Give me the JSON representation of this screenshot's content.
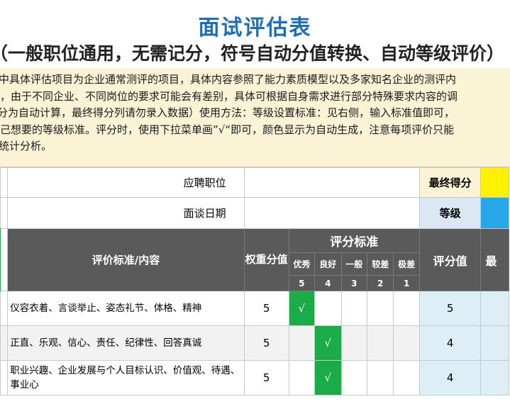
{
  "title": "面试评估表",
  "subtitle": "（一般职位通用，无需记分，符号自动分值转换、自动等级评价）",
  "description_lines": [
    "中具体评估项目为企业通常测评的项目，具体内容参照了能力素质模型以及多家知名企业的测评内",
    "，由于不同企业、不同岗位的要求可能会有差别，具体可根据自身需求进行部分特殊要求内容的调",
    "分为自动计算，最终得分列请勿录入数据）使用方法：等级设置标准：见右侧，输入标准值即可，",
    "己想要的等级标准。评分时，使用下拉菜单画”√“即可，颜色显示为自动生成，注意每项评价只能",
    "统计分析。"
  ],
  "info": {
    "position_label": "应聘职位",
    "position_value": "",
    "date_label": "面谈日期",
    "date_value": "",
    "final_score_label": "最终得分",
    "grade_label": "等级"
  },
  "header": {
    "criteria": "评价标准/内容",
    "weight": "权重分值",
    "standard": "评分标准",
    "score_value": "评分值",
    "cut_label": "最",
    "levels": [
      "优秀",
      "良好",
      "一般",
      "较差",
      "极差"
    ],
    "level_points": [
      "5",
      "4",
      "3",
      "2",
      "1"
    ]
  },
  "rows": [
    {
      "content": "仪容衣着、言谈举止、姿态礼节、体格、精神",
      "weight": "5",
      "checked_level": 0,
      "mark": "√",
      "score": "5"
    },
    {
      "content": "正直、乐观、信心、责任、纪律性、回答真诚",
      "weight": "5",
      "checked_level": 1,
      "mark": "√",
      "score": "4"
    },
    {
      "content": "职业兴趣、企业发展与个人目标认识、价值观、待遇、事业心",
      "weight": "5",
      "checked_level": 1,
      "mark": "√",
      "score": "4"
    }
  ],
  "colors": {
    "title": "#1f6db5",
    "description_bg": "#fbf3d6",
    "header_dark": "#5a5a5a",
    "check_green": "#1bab49",
    "score_bg": "#ddeef7",
    "final_score_fill": "#fff200",
    "grade_fill": "#27a7e7"
  }
}
